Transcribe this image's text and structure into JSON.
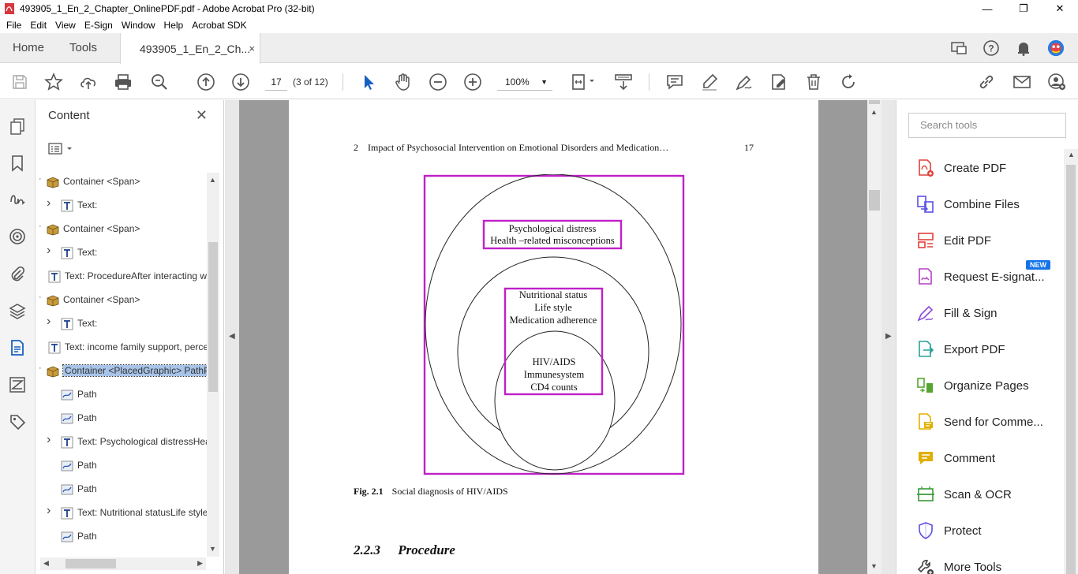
{
  "window": {
    "title": "493905_1_En_2_Chapter_OnlinePDF.pdf - Adobe Acrobat Pro (32-bit)",
    "minimize": "—",
    "maximize": "❐",
    "close": "✕"
  },
  "menu": [
    "File",
    "Edit",
    "View",
    "E-Sign",
    "Window",
    "Help",
    "Acrobat SDK"
  ],
  "tabs": {
    "home": "Home",
    "tools": "Tools",
    "document": "493905_1_En_2_Ch...",
    "close": "×"
  },
  "toolbar": {
    "page_number": "17",
    "page_of": "(3 of 12)",
    "zoom": "100%"
  },
  "content_panel": {
    "title": "Content",
    "close": "✕",
    "tree": [
      {
        "label": "Container <Span>",
        "type": "container",
        "expand": "dot"
      },
      {
        "label": "Text:",
        "type": "text",
        "expand": "chevron"
      },
      {
        "label": "Container <Span>",
        "type": "container",
        "expand": "dot"
      },
      {
        "label": "Text:",
        "type": "text",
        "expand": "chevron"
      },
      {
        "label": "Text: ProcedureAfter interacting w",
        "type": "text",
        "expand": "none"
      },
      {
        "label": "Container <Span>",
        "type": "container",
        "expand": "dot"
      },
      {
        "label": "Text:",
        "type": "text",
        "expand": "chevron"
      },
      {
        "label": "Text: income family support, perce",
        "type": "text",
        "expand": "none"
      },
      {
        "label": "Container <PlacedGraphic> PathP",
        "type": "container",
        "expand": "dot",
        "selected": true
      },
      {
        "label": "Path",
        "type": "path",
        "expand": "none"
      },
      {
        "label": "Path",
        "type": "path",
        "expand": "none"
      },
      {
        "label": "Text: Psychological distressHea",
        "type": "text",
        "expand": "chevron"
      },
      {
        "label": "Path",
        "type": "path",
        "expand": "none"
      },
      {
        "label": "Path",
        "type": "path",
        "expand": "none"
      },
      {
        "label": "Text: Nutritional statusLife style",
        "type": "text",
        "expand": "chevron"
      },
      {
        "label": "Path",
        "type": "path",
        "expand": "none"
      }
    ]
  },
  "document": {
    "running_head_num": "2",
    "running_head": "Impact of Psychosocial Intervention on Emotional Disorders and Medication…",
    "page_number": "17",
    "figure": {
      "outer_lines": [
        "Psychological distress",
        "Health –related misconceptions"
      ],
      "middle_lines": [
        "Nutritional status",
        "Life style",
        "Medication adherence"
      ],
      "inner_lines": [
        "HIV/AIDS",
        "Immunesystem",
        "CD4 counts"
      ],
      "highlight_color": "#c020c8"
    },
    "caption_label": "Fig. 2.1",
    "caption_text": "Social diagnosis of HIV/AIDS",
    "section_num": "2.2.3",
    "section_title": "Procedure"
  },
  "tools_pane": {
    "search_placeholder": "Search tools",
    "new_badge": "NEW",
    "tools": [
      {
        "label": "Create PDF",
        "icon": "create-pdf-icon",
        "color": "#e0413c"
      },
      {
        "label": "Combine Files",
        "icon": "combine-files-icon",
        "color": "#5c4ee5"
      },
      {
        "label": "Edit PDF",
        "icon": "edit-pdf-icon",
        "color": "#e0413c"
      },
      {
        "label": "Request E-signat...",
        "icon": "request-esign-icon",
        "color": "#b440c4"
      },
      {
        "label": "Fill & Sign",
        "icon": "fill-sign-icon",
        "color": "#8a4ad8"
      },
      {
        "label": "Export PDF",
        "icon": "export-pdf-icon",
        "color": "#2aa198"
      },
      {
        "label": "Organize Pages",
        "icon": "organize-pages-icon",
        "color": "#55a630"
      },
      {
        "label": "Send for Comme...",
        "icon": "send-comment-icon",
        "color": "#e0b000"
      },
      {
        "label": "Comment",
        "icon": "comment-icon",
        "color": "#e0b000"
      },
      {
        "label": "Scan & OCR",
        "icon": "scan-ocr-icon",
        "color": "#3a9a3a"
      },
      {
        "label": "Protect",
        "icon": "protect-icon",
        "color": "#5c4ee5"
      },
      {
        "label": "More Tools",
        "icon": "more-tools-icon",
        "color": "#444444"
      }
    ]
  }
}
